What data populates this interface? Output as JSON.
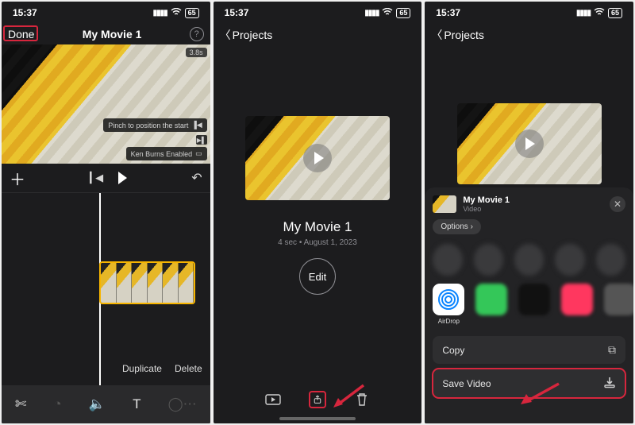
{
  "time": "15:37",
  "battery": "65",
  "screens": {
    "s1": {
      "done": "Done",
      "title": "My Movie 1",
      "duration_badge": "3.8s",
      "hint_pinch": "Pinch to position the start",
      "hint_kb": "Ken Burns Enabled",
      "dup": "Duplicate",
      "del": "Delete"
    },
    "s2": {
      "back": "Projects",
      "movie_title": "My Movie 1",
      "movie_info": "4 sec • August 1, 2023",
      "edit": "Edit"
    },
    "s3": {
      "back": "Projects",
      "sheet_title": "My Movie 1",
      "sheet_sub": "Video",
      "options": "Options",
      "airdrop": "AirDrop",
      "copy": "Copy",
      "save": "Save Video"
    }
  }
}
